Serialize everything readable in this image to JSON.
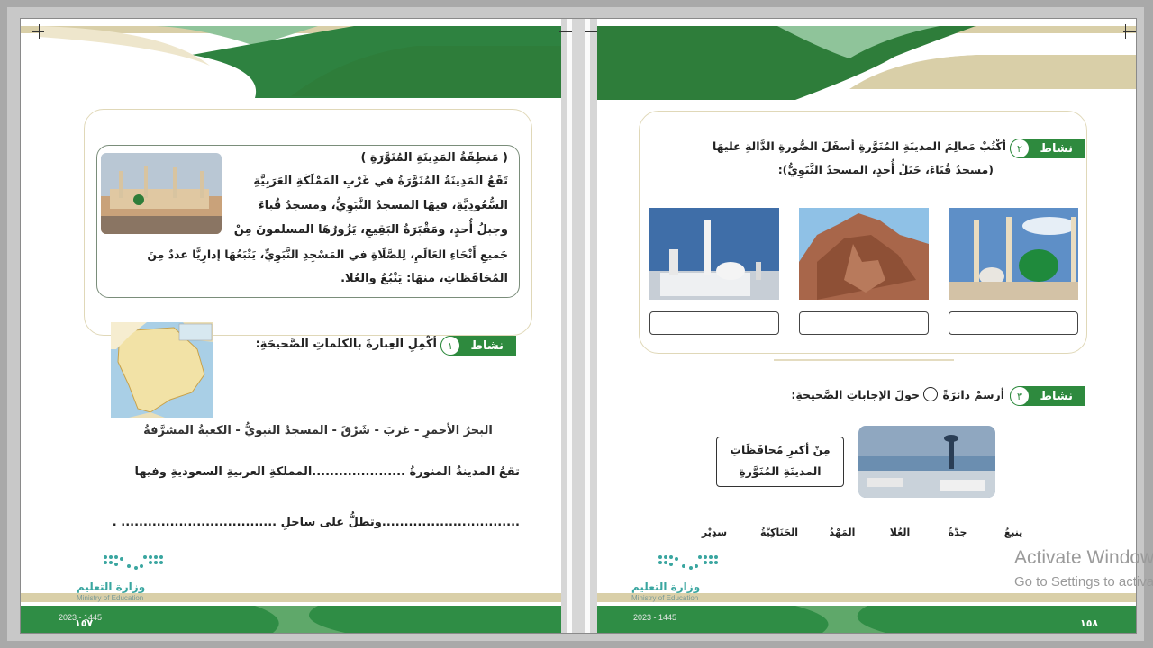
{
  "left_page": {
    "region_box": {
      "title": "( مَنطِقَةُ المَدِينَةِ المُنَوَّرَةِ )",
      "lines": [
        "تَقَعُ المَدِينَةُ المُنَوَّرَةُ في غَرْبِ المَمْلَكَةِ العَرَبِيَّةِ",
        "السُّعُودِيَّةِ، فيهَا المسجدُ النَّبَوِيُّ، ومسجدُ قُباءَ",
        "وجبلُ أُحدٍ، ومَقْبَرَةُ البَقِيعِ، يَزُورُهَا المسلمونَ مِنْ",
        "جَميعِ أَنْحَاءِ العَالَمِ، لِلصَّلَاةِ في المَسْجِدِ النَّبَوِيِّ، يَتْبَعُهَا إدارِيًّا عددٌ مِنَ",
        "المُحَافَظاتِ، منهَا: يَنْبُعُ والعُلا."
      ]
    },
    "activity1": {
      "badge": "نشاط",
      "number": "١",
      "instruction": "أكْمِلِ العِبارةَ بالكلماتِ الصَّحيحَةِ:",
      "word_bank": "البحرُ الأحمرِ - غربَ - شَرْقَ - المسجدُ النبويُّ - الكعبةُ المشرَّفةُ",
      "sentence1": "تقعُ المدينةُ المنورةُ .....................المملكةِ العربيةِ السعوديةِ وفيها",
      "sentence2": "...............................وتطلُّ على ساحلِ ................................... ."
    },
    "ministry": {
      "name": "وزارة التعليم",
      "sub": "Ministry of Education",
      "year": "2023 - 1445"
    },
    "page_number": "١٥٧"
  },
  "right_page": {
    "activity2": {
      "badge": "نشاط",
      "number": "٢",
      "instruction": "أكْتُبْ مَعالِمَ المدينَةِ المُنَوَّرةِ أسفَلَ الصُّورةِ الدَّالةِ عليهَا",
      "options": "(مسجدُ قُبَاءَ، جَبَلُ أُحدٍ، المسجدُ النَّبَوِيُّ):",
      "answers": [
        "",
        "",
        ""
      ]
    },
    "activity3": {
      "badge": "نشاط",
      "number": "٣",
      "instruction": "أرسمْ دائرَةً",
      "instruction_tail": "حولَ الإجاباتِ الصَّحيحةِ:",
      "question": [
        "مِنْ أكبرِ مُحافَظَاتِ",
        "المدينَةِ المُنَوَّرةِ"
      ],
      "choices": [
        "ينبعُ",
        "جدَّةُ",
        "العُلا",
        "المَهْدُ",
        "الحَنَاكِيَّةُ",
        "سدِيْر"
      ]
    },
    "ministry": {
      "name": "وزارة التعليم",
      "sub": "Ministry of Education",
      "year": "2023 - 1445"
    },
    "page_number": "١٥٨"
  },
  "windows_watermark": {
    "line1": "Activate Windows",
    "line2": "Go to Settings to activate Windows."
  },
  "colors": {
    "green_dark": "#2e7d3a",
    "green_light": "#5fa86a",
    "beige": "#d9cfa8",
    "footer_green": "#2f8d45"
  }
}
